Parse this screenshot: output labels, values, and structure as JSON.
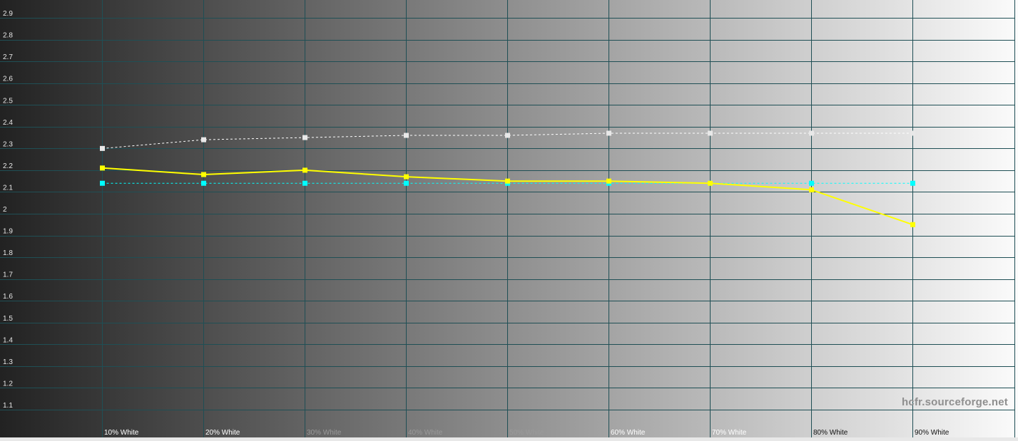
{
  "chart_data": {
    "type": "line",
    "title": "",
    "xlabel": "",
    "ylabel": "",
    "categories": [
      "10% White",
      "20% White",
      "30% White",
      "40% White",
      "50% White",
      "60% White",
      "70% White",
      "80% White",
      "90% White"
    ],
    "y_ticks": [
      "1.1",
      "1.2",
      "1.3",
      "1.4",
      "1.5",
      "1.6",
      "1.7",
      "1.8",
      "1.9",
      "2",
      "2.1",
      "2.2",
      "2.3",
      "2.4",
      "2.5",
      "2.6",
      "2.7",
      "2.8",
      "2.9"
    ],
    "ylim": [
      1.0,
      3.0
    ],
    "grid": true,
    "series": [
      {
        "color": "#ffff00",
        "style": "solid",
        "values": [
          2.21,
          2.18,
          2.2,
          2.17,
          2.15,
          2.15,
          2.14,
          2.11,
          1.95
        ]
      },
      {
        "color": "#00ffff",
        "style": "dashed",
        "values": [
          2.14,
          2.14,
          2.14,
          2.14,
          2.14,
          2.14,
          2.14,
          2.14,
          2.14
        ]
      },
      {
        "color": "#ffffff",
        "style": "dashed",
        "values": [
          2.3,
          2.34,
          2.35,
          2.36,
          2.36,
          2.37,
          2.37,
          2.37,
          2.37
        ]
      }
    ]
  },
  "watermark": "hcfr.sourceforge.net",
  "colors": {
    "grid": "#1f4f55",
    "background_dark": "#222222",
    "background_light": "#fafafa"
  }
}
